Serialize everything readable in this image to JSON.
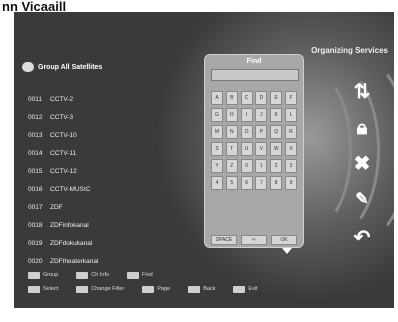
{
  "caption": "nn    Vicaaill",
  "screen": {
    "title": "Organizing Services",
    "list_header": "Group All Satellites",
    "channels": [
      {
        "num": "0011",
        "name": "CCTV-2"
      },
      {
        "num": "0012",
        "name": "CCTV-3"
      },
      {
        "num": "0013",
        "name": "CCTV-10"
      },
      {
        "num": "0014",
        "name": "CCTV-11"
      },
      {
        "num": "0015",
        "name": "CCTV-12"
      },
      {
        "num": "0016",
        "name": "CCTV-MUSIC"
      },
      {
        "num": "0017",
        "name": "ZDF"
      },
      {
        "num": "0018",
        "name": "ZDFinfokanal"
      },
      {
        "num": "0019",
        "name": "ZDFdokukanal"
      },
      {
        "num": "0020",
        "name": "ZDFtheaterkanal"
      }
    ],
    "keyboard": {
      "title": "Find",
      "input_value": "",
      "keys": [
        "A",
        "B",
        "C",
        "D",
        "E",
        "F",
        "G",
        "H",
        "I",
        "J",
        "K",
        "L",
        "M",
        "N",
        "O",
        "P",
        "Q",
        "R",
        "S",
        "T",
        "U",
        "V",
        "W",
        "X",
        "Y",
        "Z",
        "0",
        "1",
        "2",
        "3",
        "4",
        "5",
        "6",
        "7",
        "8",
        "9"
      ],
      "space_label": "SPACE",
      "back_label": "<-",
      "ok_label": "OK"
    },
    "side_icons": [
      "move-icon",
      "lock-icon",
      "delete-icon",
      "rename-icon",
      "undo-icon"
    ],
    "footer": {
      "row1": [
        {
          "key": "F1",
          "label": "Group"
        },
        {
          "key": "F2",
          "label": "Ch Info"
        },
        {
          "key": "F3",
          "label": "Find"
        }
      ],
      "row2": [
        {
          "key": "OK",
          "label": "Select"
        },
        {
          "key": "CH",
          "label": "Change Filter"
        },
        {
          "key": "PG",
          "label": "Page"
        },
        {
          "key": "EXIT",
          "label": "Back"
        },
        {
          "key": "MENU",
          "label": "Exit"
        }
      ]
    }
  }
}
